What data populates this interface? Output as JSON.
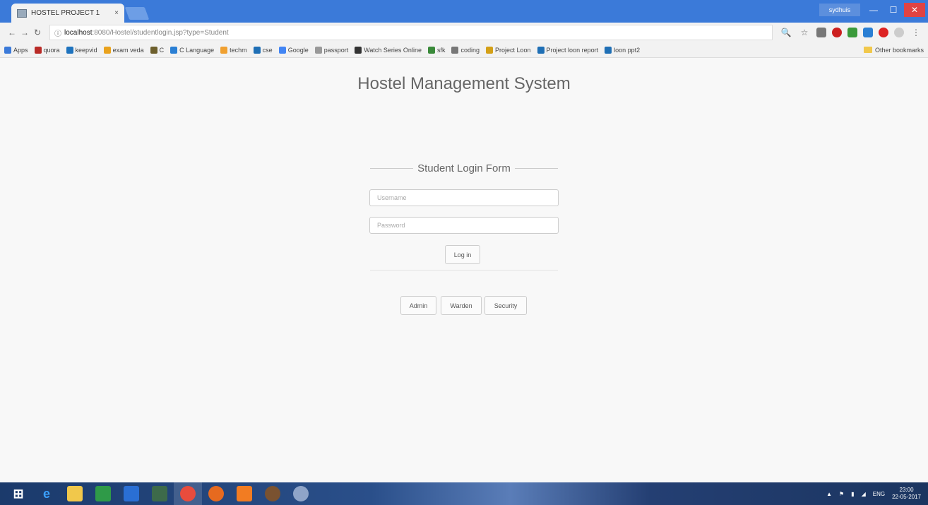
{
  "browser": {
    "tab_title": "HOSTEL PROJECT 1",
    "tab_close": "×",
    "user_badge": "sydhuis",
    "window_controls": {
      "minimize": "—",
      "maximize": "☐",
      "close": "✕"
    },
    "address": {
      "host": "localhost",
      "path": ":8080/Hostel/studentlogin.jsp?type=Student"
    },
    "bookmarks": [
      {
        "label": "Apps",
        "color": "#3b7ad9"
      },
      {
        "label": "quora",
        "color": "#b92b27"
      },
      {
        "label": "keepvid",
        "color": "#1e73be"
      },
      {
        "label": "exam veda",
        "color": "#e9a21d"
      },
      {
        "label": "C",
        "color": "#6d5f2c"
      },
      {
        "label": "C Language",
        "color": "#2a7fd4"
      },
      {
        "label": "techm",
        "color": "#f0a030"
      },
      {
        "label": "cse",
        "color": "#1f6fb5"
      },
      {
        "label": "Google",
        "color": "#4285f4"
      },
      {
        "label": "passport",
        "color": "#999999"
      },
      {
        "label": "Watch Series Online",
        "color": "#333333"
      },
      {
        "label": "sfk",
        "color": "#3a8a3a"
      },
      {
        "label": "coding",
        "color": "#777777"
      },
      {
        "label": "Project Loon",
        "color": "#d4a017"
      },
      {
        "label": "Project loon report",
        "color": "#1f6fb5"
      },
      {
        "label": "loon ppt2",
        "color": "#1f6fb5"
      }
    ],
    "other_bookmarks": "Other bookmarks"
  },
  "page": {
    "title": "Hostel Management System",
    "form_legend": "Student Login Form",
    "username_placeholder": "Username",
    "password_placeholder": "Password",
    "login_label": "Log in",
    "role_buttons": {
      "admin": "Admin",
      "warden": "Warden",
      "security": "Security"
    }
  },
  "taskbar": {
    "language": "ENG",
    "time": "23:00",
    "date": "22-05-2017"
  }
}
